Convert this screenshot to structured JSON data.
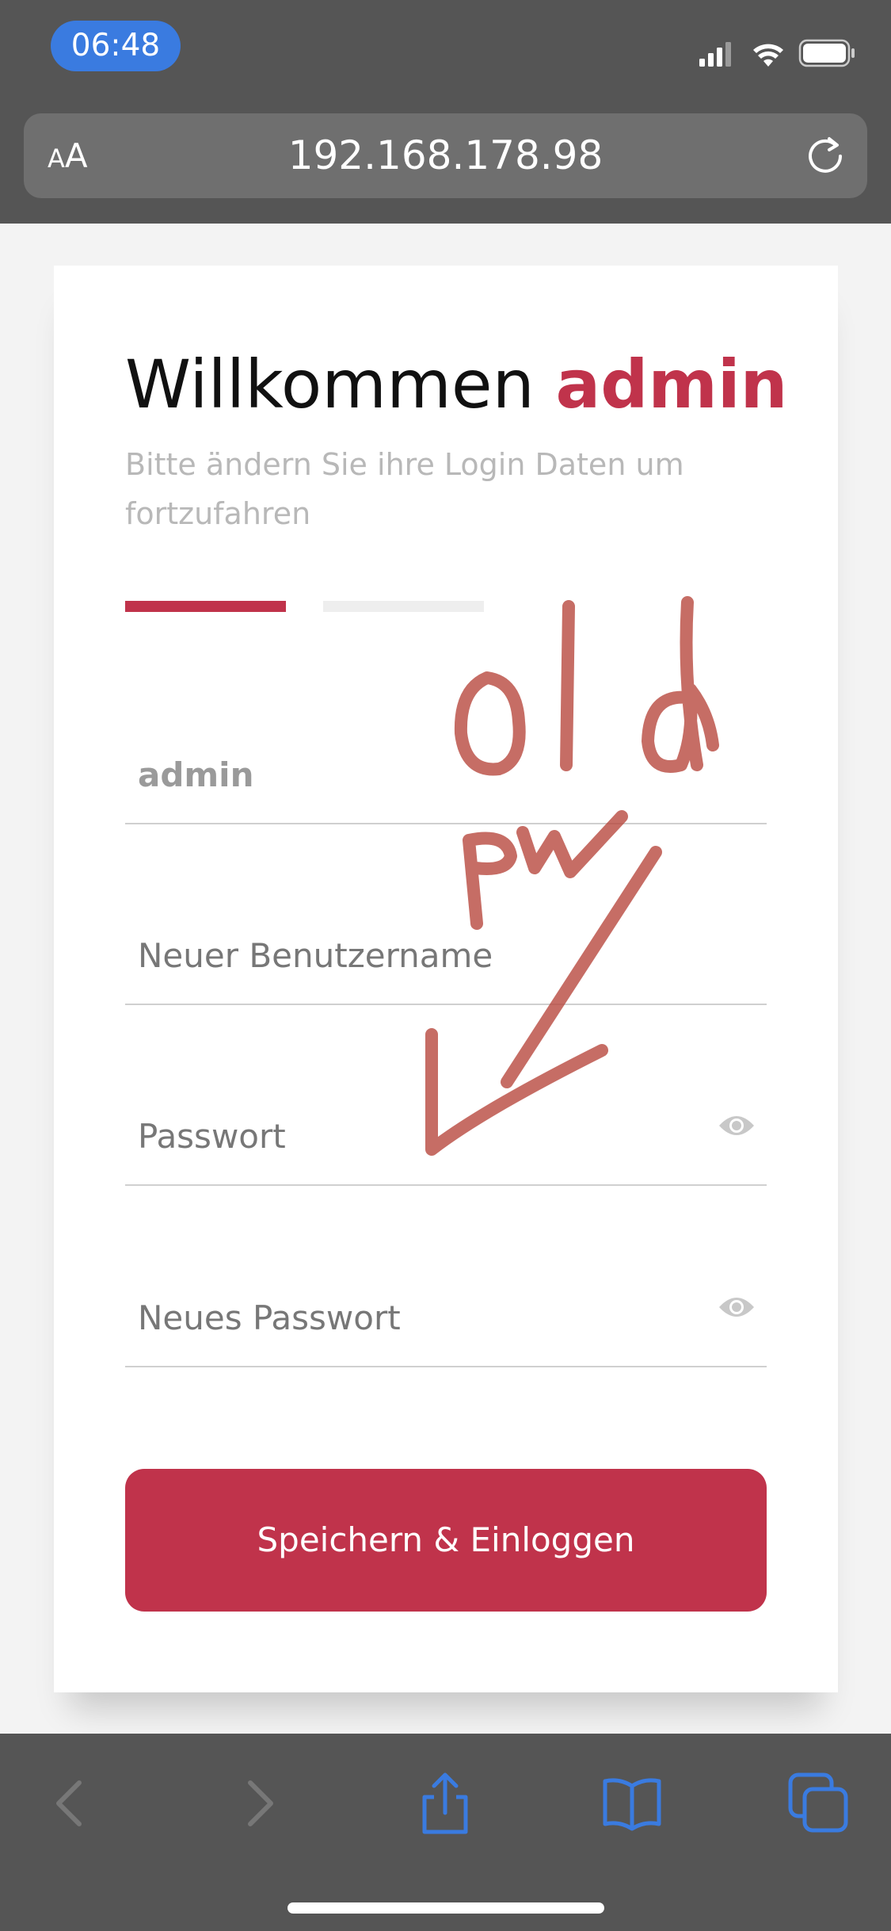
{
  "status_bar": {
    "time": "06:48",
    "icons": [
      "signal-icon",
      "wifi-icon",
      "battery-icon"
    ]
  },
  "browser": {
    "text_size_label_small": "A",
    "text_size_label_large": "A",
    "url": "192.168.178.98"
  },
  "form": {
    "title_prefix": "Willkommen ",
    "title_user": "admin",
    "subtitle": "Bitte ändern Sie ihre Login Daten um fortzufahren",
    "steps_total": 2,
    "step_active": 1,
    "fields": [
      {
        "value": "admin",
        "placeholder": ""
      },
      {
        "value": "",
        "placeholder": "Neuer Benutzername"
      },
      {
        "value": "",
        "placeholder": "Passwort",
        "icon": "eye-icon"
      },
      {
        "value": "",
        "placeholder": "Neues Passwort",
        "icon": "eye-icon"
      }
    ],
    "submit_label": "Speichern & Einloggen"
  },
  "annotation": {
    "text": "old pw",
    "color": "#b8493f"
  },
  "colors": {
    "accent": "#c0334b",
    "chrome": "#555555",
    "toolbar_icon": "#3a7be0"
  },
  "toolbar": {
    "icons": [
      "back-icon",
      "forward-icon",
      "share-icon",
      "bookmarks-icon",
      "tabs-icon"
    ]
  }
}
